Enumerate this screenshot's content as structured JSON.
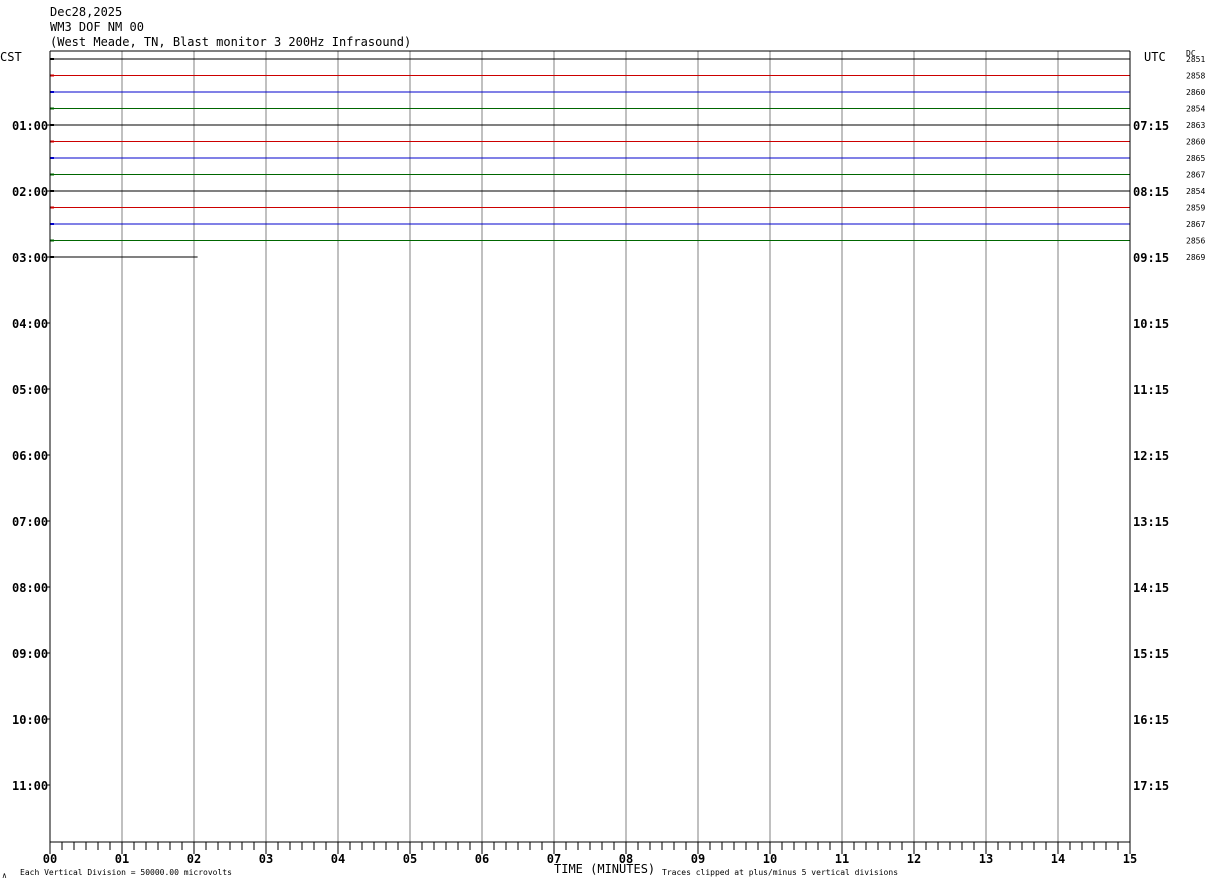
{
  "header": {
    "date": "Dec28,2025",
    "station": "WM3 DOF NM 00",
    "description": "(West Meade, TN, Blast monitor 3 200Hz Infrasound)"
  },
  "left_timezone": "CST",
  "right_timezone": "UTC",
  "dc_header": "DC",
  "footer": {
    "corner_mark": "∧",
    "scale_note": "Each Vertical Division = 50000.00 microvolts",
    "axis_title": "TIME (MINUTES)",
    "clip_note": "Traces clipped at plus/minus 5 vertical divisions"
  },
  "colors": {
    "trace_cycle": [
      "#000000",
      "#cc0000",
      "#0000cc",
      "#006600"
    ],
    "grid": "#808080",
    "frame": "#000000",
    "background": "#ffffff"
  },
  "chart_data": {
    "type": "line",
    "title": "WM3 DOF NM 00",
    "xlabel": "TIME (MINUTES)",
    "xlim": [
      0,
      15
    ],
    "x_ticks": [
      "00",
      "01",
      "02",
      "03",
      "04",
      "05",
      "06",
      "07",
      "08",
      "09",
      "10",
      "11",
      "12",
      "13",
      "14",
      "15"
    ],
    "rows_per_hour": 4,
    "minutes_per_row": 15,
    "hour_labels_left": [
      "01:00",
      "02:00",
      "03:00",
      "04:00",
      "05:00",
      "06:00",
      "07:00",
      "08:00",
      "09:00",
      "10:00",
      "11:00"
    ],
    "hour_labels_right": [
      "07:15",
      "08:15",
      "09:15",
      "10:15",
      "11:15",
      "12:15",
      "13:15",
      "14:15",
      "15:15",
      "16:15",
      "17:15"
    ],
    "traces": [
      {
        "row": 0,
        "start_min": 0,
        "end_min": 15,
        "dc": "2851"
      },
      {
        "row": 1,
        "start_min": 0,
        "end_min": 15,
        "dc": "2858"
      },
      {
        "row": 2,
        "start_min": 0,
        "end_min": 15,
        "dc": "2860"
      },
      {
        "row": 3,
        "start_min": 0,
        "end_min": 15,
        "dc": "2854"
      },
      {
        "row": 4,
        "start_min": 0,
        "end_min": 15,
        "dc": "2863"
      },
      {
        "row": 5,
        "start_min": 0,
        "end_min": 15,
        "dc": "2860"
      },
      {
        "row": 6,
        "start_min": 0,
        "end_min": 15,
        "dc": "2865"
      },
      {
        "row": 7,
        "start_min": 0,
        "end_min": 15,
        "dc": "2867"
      },
      {
        "row": 8,
        "start_min": 0,
        "end_min": 15,
        "dc": "2854"
      },
      {
        "row": 9,
        "start_min": 0,
        "end_min": 15,
        "dc": "2859"
      },
      {
        "row": 10,
        "start_min": 0,
        "end_min": 15,
        "dc": "2867"
      },
      {
        "row": 11,
        "start_min": 0,
        "end_min": 15,
        "dc": "2856"
      },
      {
        "row": 12,
        "start_min": 0,
        "end_min": 2.05,
        "dc": "2869"
      }
    ]
  }
}
